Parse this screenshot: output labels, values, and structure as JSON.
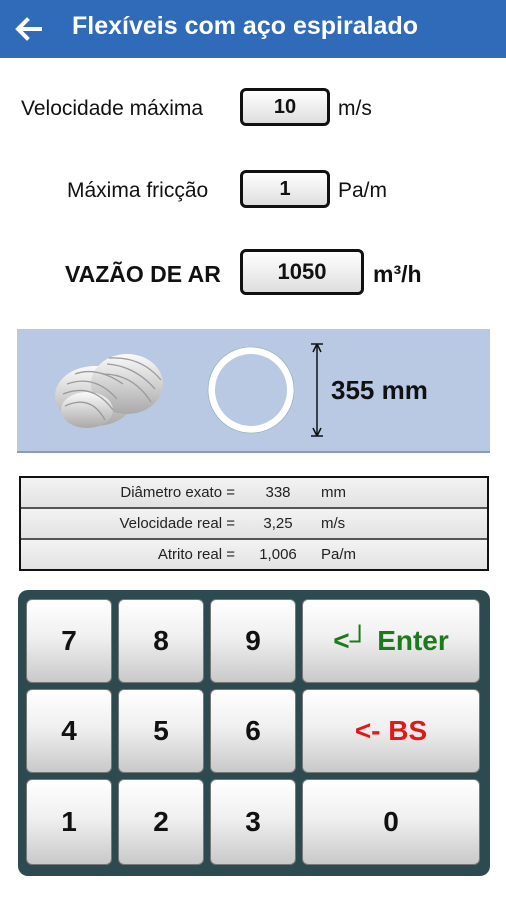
{
  "header": {
    "title": "Flexíveis com aço espiralado",
    "back_icon": "arrow-left-icon"
  },
  "inputs": {
    "velocity": {
      "label": "Velocidade máxima",
      "value": "10",
      "unit": "m/s"
    },
    "friction": {
      "label": "Máxima fricção",
      "value": "1",
      "unit": "Pa/m"
    },
    "airflow": {
      "label": "VAZÃO DE AR",
      "value": "1050",
      "unit": "m³/h"
    }
  },
  "result_panel": {
    "diameter": "355 mm",
    "image": "flexible-duct-image",
    "ring_icon": "duct-section-icon"
  },
  "results": [
    {
      "label": "Diâmetro exato =",
      "value": "338",
      "unit": "mm"
    },
    {
      "label": "Velocidade real =",
      "value": "3,25",
      "unit": "m/s"
    },
    {
      "label": "Atrito real =",
      "value": "1,006",
      "unit": "Pa/m"
    }
  ],
  "keypad": {
    "keys": [
      "7",
      "8",
      "9",
      "4",
      "5",
      "6",
      "1",
      "2",
      "3"
    ],
    "enter": "<┘ Enter",
    "backspace": "<- BS",
    "zero": "0",
    "colors": {
      "background": "#2c4a4f",
      "enter": "#1b7a1b",
      "backspace": "#e01818"
    }
  },
  "colors": {
    "appbar": "#2f6bb8",
    "panel": "#b9c9e3"
  }
}
